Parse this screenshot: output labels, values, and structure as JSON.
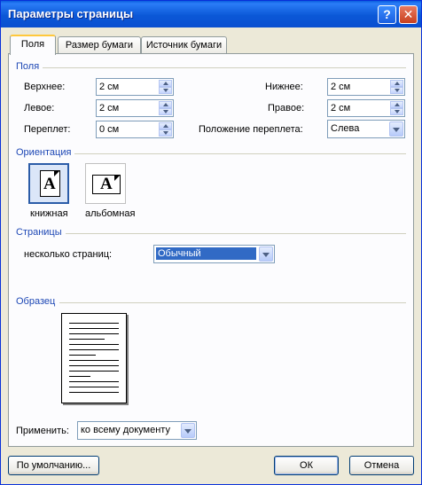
{
  "window": {
    "title": "Параметры страницы",
    "help_glyph": "?",
    "close_glyph": "✕"
  },
  "tabs": [
    {
      "label": "Поля",
      "active": true
    },
    {
      "label": "Размер бумаги",
      "active": false
    },
    {
      "label": "Источник бумаги",
      "active": false
    }
  ],
  "margins": {
    "group_label": "Поля",
    "top": {
      "label": "Верхнее:",
      "value": "2 см"
    },
    "bottom": {
      "label": "Нижнее:",
      "value": "2 см"
    },
    "left": {
      "label": "Левое:",
      "value": "2 см"
    },
    "right": {
      "label": "Правое:",
      "value": "2 см"
    },
    "gutter": {
      "label": "Переплет:",
      "value": "0 см"
    },
    "gutter_position": {
      "label": "Положение переплета:",
      "value": "Слева"
    }
  },
  "orientation": {
    "group_label": "Ориентация",
    "portrait": {
      "label": "книжная",
      "glyph": "A",
      "selected": true
    },
    "landscape": {
      "label": "альбомная",
      "glyph": "A",
      "selected": false
    }
  },
  "pages": {
    "group_label": "Страницы",
    "multiple_label": "несколько страниц:",
    "multiple_value": "Обычный"
  },
  "preview": {
    "group_label": "Образец"
  },
  "apply": {
    "label": "Применить:",
    "value": "ко всему документу"
  },
  "buttons": {
    "default_label": "По умолчанию...",
    "ok_label": "ОК",
    "cancel_label": "Отмена"
  },
  "colors": {
    "title_bar": "#0a5dde",
    "group_label": "#1e48b5",
    "selection": "#316ac5",
    "dialog_bg": "#ece9d8"
  }
}
